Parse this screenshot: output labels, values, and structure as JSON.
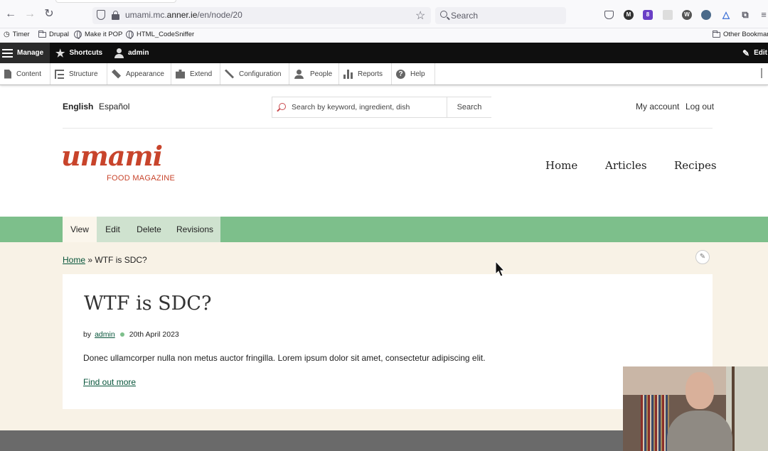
{
  "browser": {
    "url_prefix": "umami.mc.",
    "url_domain": "anner.ie",
    "url_path": "/en/node/20",
    "search_placeholder": "Search",
    "extension_badge": "8"
  },
  "bookmarks": [
    {
      "label": "Timer",
      "icon": "timer-icon"
    },
    {
      "label": "Drupal",
      "icon": "folder-icon"
    },
    {
      "label": "Make it POP",
      "icon": "globe-icon"
    },
    {
      "label": "HTML_CodeSniffer",
      "icon": "globe-icon"
    }
  ],
  "bookmarks_other": "Other Bookmarks",
  "toolbar": {
    "manage": "Manage",
    "shortcuts": "Shortcuts",
    "user": "admin",
    "edit": "Edit",
    "tray": [
      "Content",
      "Structure",
      "Appearance",
      "Extend",
      "Configuration",
      "People",
      "Reports",
      "Help"
    ]
  },
  "header": {
    "languages": [
      "English",
      "Español"
    ],
    "search_placeholder": "Search by keyword, ingredient, dish",
    "search_button": "Search",
    "my_account": "My account",
    "log_out": "Log out"
  },
  "logo": {
    "word": "umami",
    "tagline": "FOOD MAGAZINE"
  },
  "main_nav": [
    "Home",
    "Articles",
    "Recipes"
  ],
  "tabs": [
    "View",
    "Edit",
    "Delete",
    "Revisions"
  ],
  "breadcrumb": {
    "home": "Home",
    "separator": "»",
    "current": "WTF is SDC?"
  },
  "article": {
    "title": "WTF is SDC?",
    "by": "by",
    "author": "admin",
    "date": "20th April 2023",
    "summary": "Donec ullamcorper nulla non metus auctor fringilla. Lorem ipsum dolor sit amet, consectetur adipiscing elit.",
    "more": "Find out more"
  },
  "colors": {
    "brand": "#c8442b",
    "tasks_bar": "#7dbf8b",
    "link": "#08553b",
    "content_bg": "#f8f2e6"
  }
}
